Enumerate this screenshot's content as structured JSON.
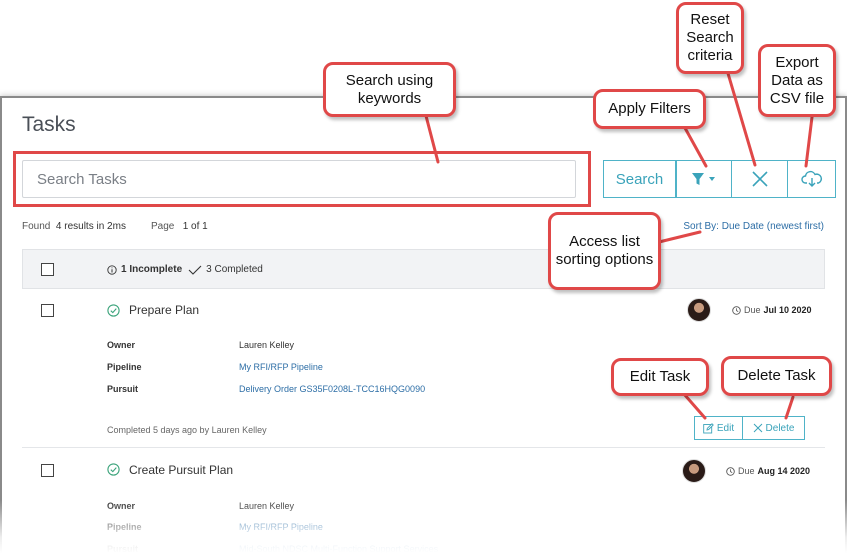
{
  "page": {
    "title": "Tasks"
  },
  "search": {
    "placeholder": "Search Tasks",
    "button_label": "Search",
    "filter_icon": "filter-funnel-icon",
    "reset_icon": "close-x-icon",
    "export_icon": "cloud-download-icon"
  },
  "results": {
    "found_label": "Found",
    "found_value": "4 results in 2ms",
    "page_label": "Page",
    "page_value": "1 of 1",
    "sort_label": "Sort By: Due Date (newest first)"
  },
  "list_header": {
    "incomplete": "1 Incomplete",
    "completed": "3 Completed"
  },
  "labels": {
    "owner": "Owner",
    "pipeline": "Pipeline",
    "pursuit": "Pursuit",
    "due": "Due"
  },
  "tasks": [
    {
      "name": "Prepare Plan",
      "due_date": "Jul 10 2020",
      "owner": "Lauren Kelley",
      "pipeline": "My RFI/RFP Pipeline",
      "pursuit": "Delivery Order GS35F0208L-TCC16HQG0090",
      "completed_text": "Completed 5 days ago by Lauren Kelley",
      "edit_label": "Edit",
      "delete_label": "Delete"
    },
    {
      "name": "Create Pursuit Plan",
      "due_date": "Aug 14 2020",
      "owner": "Lauren Kelley",
      "pipeline": "My RFI/RFP Pipeline",
      "pursuit": "Mid-South NDSC Multi-Function Support Services"
    }
  ],
  "callouts": {
    "search_keywords": "Search using keywords",
    "apply_filters": "Apply Filters",
    "reset_search": "Reset Search criteria",
    "export_csv": "Export Data as CSV file",
    "sorting": "Access list sorting options",
    "edit_task": "Edit Task",
    "delete_task": "Delete Task"
  },
  "colors": {
    "accent": "#3aa3ba",
    "callout_border": "#e04848",
    "link": "#2d6ea6"
  }
}
